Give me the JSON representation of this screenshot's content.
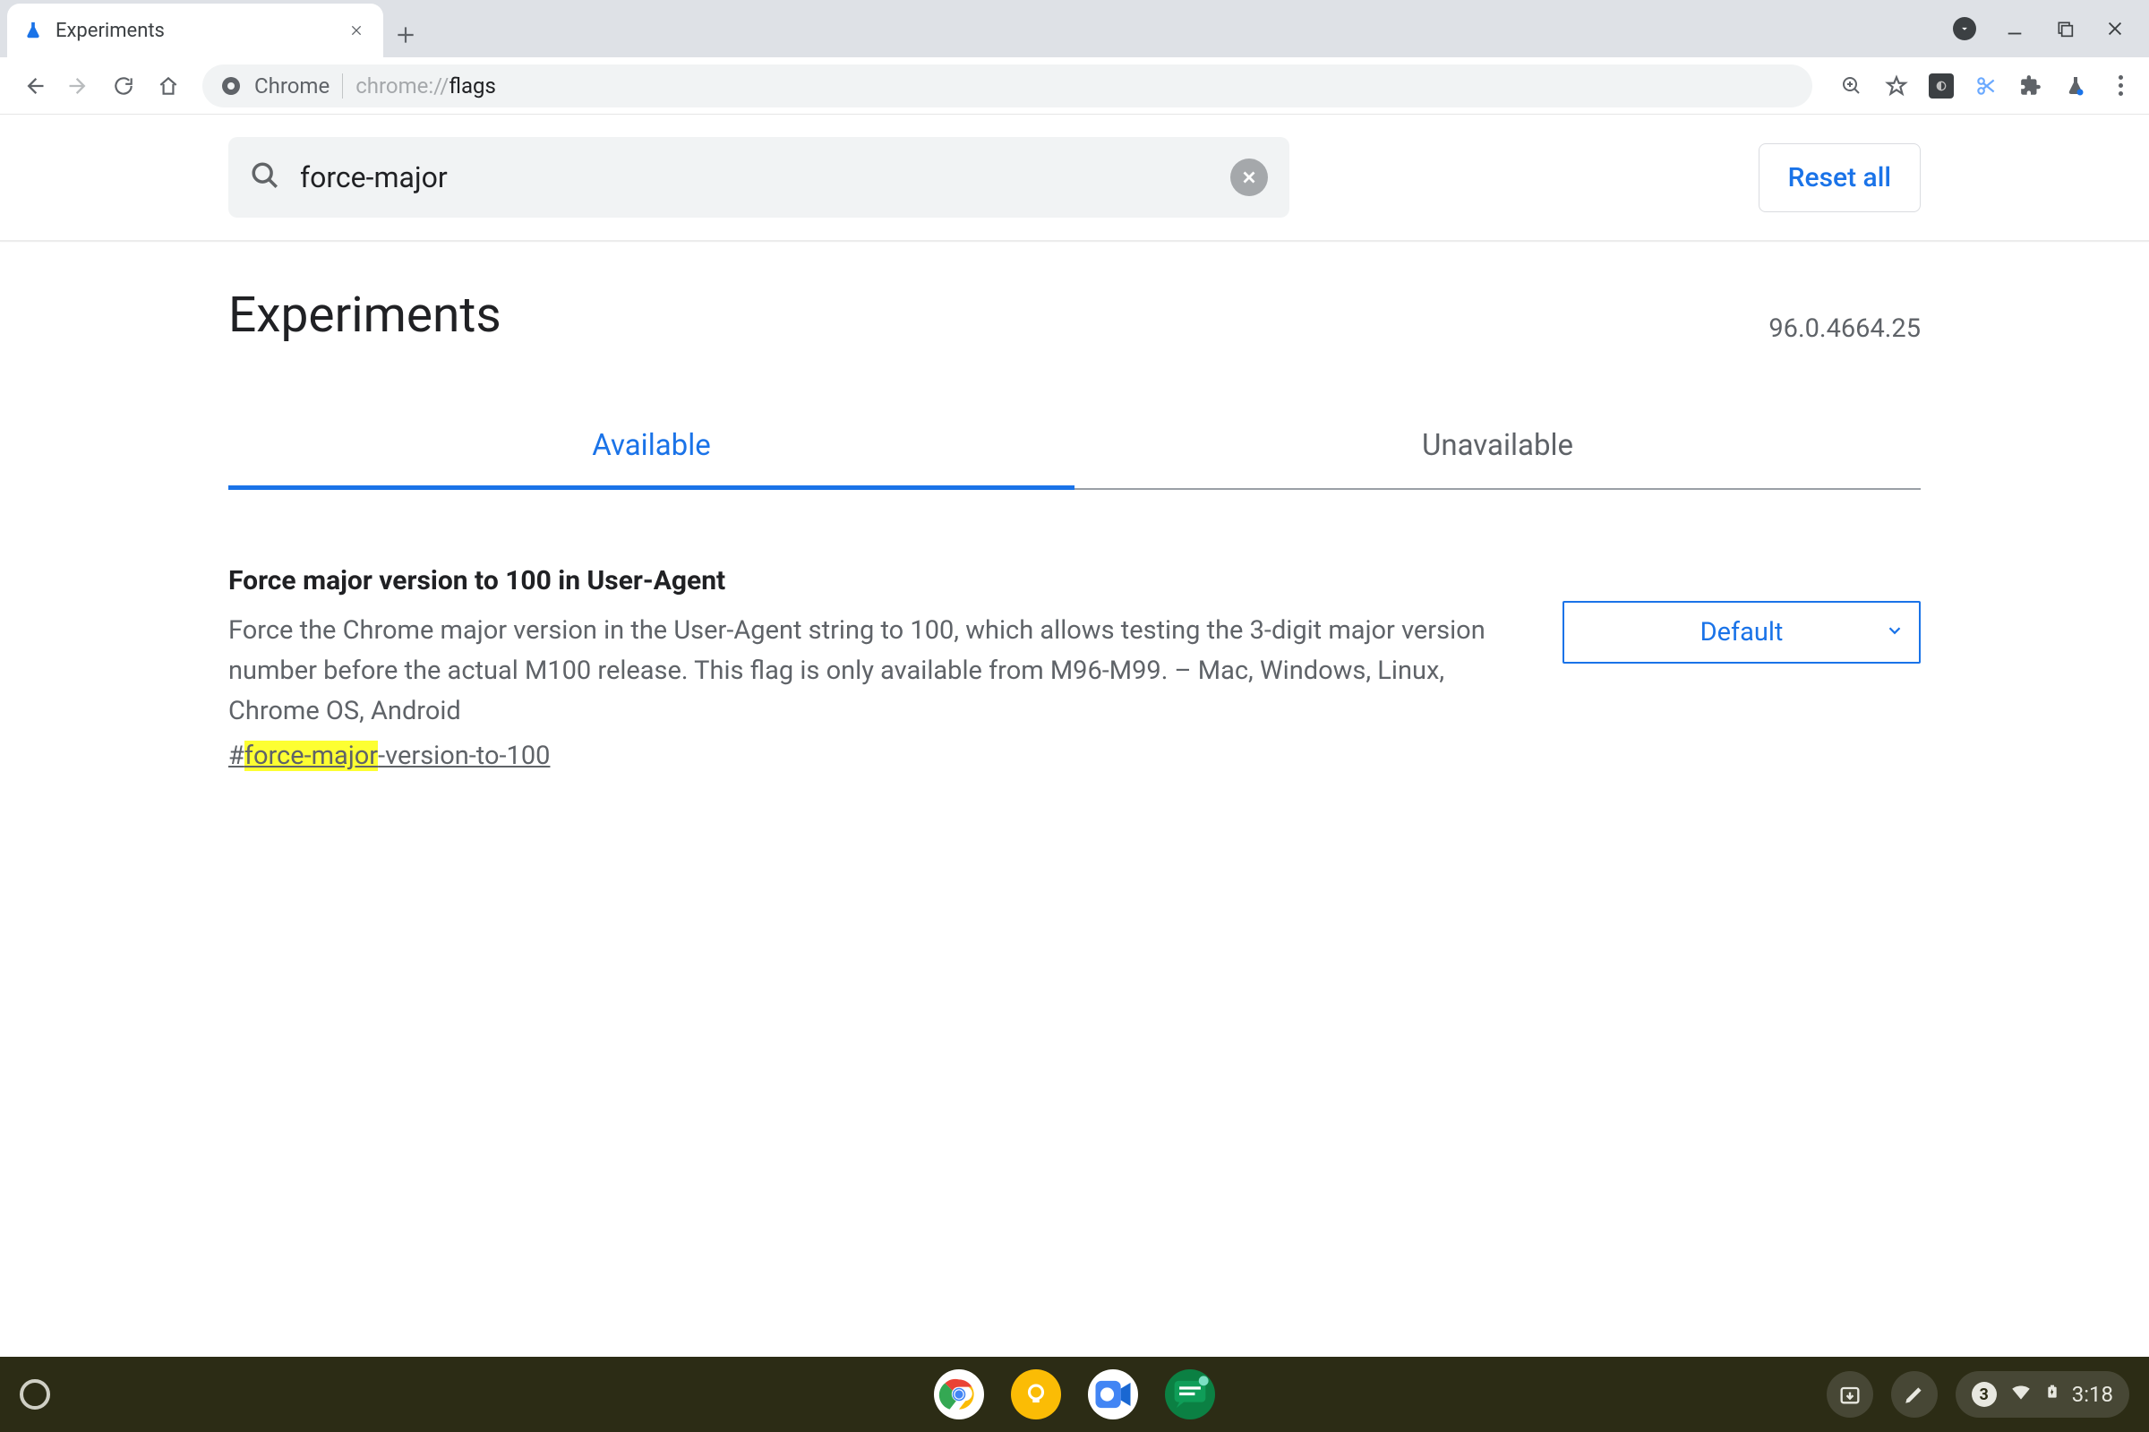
{
  "browser": {
    "tab_title": "Experiments",
    "omnibox_chip": "Chrome",
    "url_prefix": "chrome://",
    "url_strong": "flags"
  },
  "search": {
    "value": "force-major",
    "reset_label": "Reset all"
  },
  "header": {
    "title": "Experiments",
    "version": "96.0.4664.25"
  },
  "tabs": {
    "available": "Available",
    "unavailable": "Unavailable"
  },
  "flag": {
    "title": "Force major version to 100 in User-Agent",
    "description": "Force the Chrome major version in the User-Agent string to 100, which allows testing the 3-digit major version number before the actual M100 release. This flag is only available from M96-M99. – Mac, Windows, Linux, Chrome OS, Android",
    "anchor_prefix": "#",
    "anchor_highlight": "force-major",
    "anchor_rest": "-version-to-100",
    "select_value": "Default"
  },
  "shelf": {
    "notification_count": "3",
    "time": "3:18"
  }
}
